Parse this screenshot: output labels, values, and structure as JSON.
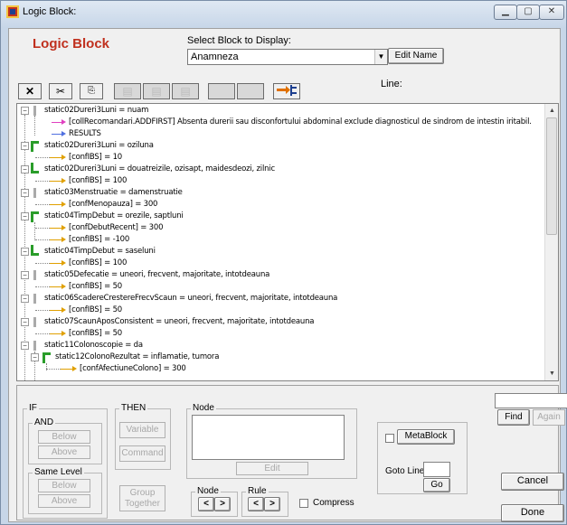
{
  "window": {
    "title": "Logic Block:"
  },
  "header": {
    "title": "Logic Block",
    "select_label": "Select Block to Display:",
    "select_value": "Anamneza",
    "edit_name": "Edit Name",
    "line_label": "Line:"
  },
  "toolbar": {
    "delete": "✕",
    "cut": "✂",
    "paste": "⎘"
  },
  "tree": {
    "rows": [
      {
        "text": "static02Dureri3Luni = nuam"
      },
      {
        "text": "[collRecomandari.ADDFIRST]  Absenta durerii sau disconfortului abdominal exclude diagnosticul de sindrom de intestin iritabil."
      },
      {
        "text": "RESULTS"
      },
      {
        "text": "static02Dureri3Luni = oziluna"
      },
      {
        "text": "[confIBS] = 10"
      },
      {
        "text": "static02Dureri3Luni = douatreizile, ozisapt, maidesdeozi, zilnic"
      },
      {
        "text": "[confIBS] = 100"
      },
      {
        "text": "static03Menstruatie = damenstruatie"
      },
      {
        "text": "[confMenopauza] =  300"
      },
      {
        "text": "static04TimpDebut = orezile, saptluni"
      },
      {
        "text": "[confDebutRecent] = 300"
      },
      {
        "text": "[confIBS] = -100"
      },
      {
        "text": "static04TimpDebut = saseluni"
      },
      {
        "text": "[confIBS] = 100"
      },
      {
        "text": "static05Defecatie = uneori, frecvent, majoritate, intotdeauna"
      },
      {
        "text": "[confIBS] = 50"
      },
      {
        "text": "static06ScadereCrestereFrecvScaun = uneori, frecvent, majoritate, intotdeauna"
      },
      {
        "text": "[confIBS] = 50"
      },
      {
        "text": "static07ScaunAposConsistent = uneori, frecvent, majoritate, intotdeauna"
      },
      {
        "text": "[confIBS] = 50"
      },
      {
        "text": "static11Colonoscopie = da"
      },
      {
        "text": "static12ColonoRezultat = inflamatie, tumora"
      },
      {
        "text": "[confAfectiuneColono] = 300"
      }
    ]
  },
  "panel": {
    "if": "IF",
    "and": "AND",
    "below": "Below",
    "above": "Above",
    "same_level": "Same Level",
    "then": "THEN",
    "variable": "Variable",
    "command": "Command",
    "group": "Group",
    "together": "Together",
    "node": "Node",
    "edit": "Edit",
    "node_nav": "Node",
    "rule_nav": "Rule",
    "prev": "<",
    "next": ">",
    "compress": "Compress",
    "metablock": "MetaBlock",
    "goto_line": "Goto Line:",
    "go": "Go",
    "find": "Find",
    "again": "Again",
    "cancel": "Cancel",
    "done": "Done"
  }
}
